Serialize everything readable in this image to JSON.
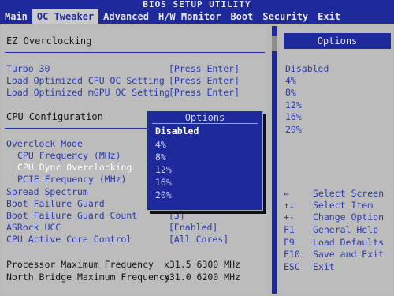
{
  "title": "BIOS SETUP UTILITY",
  "menu": [
    "Main",
    "OC Tweaker",
    "Advanced",
    "H/W Monitor",
    "Boot",
    "Security",
    "Exit"
  ],
  "left": {
    "section1": "EZ Overclocking",
    "items1": [
      {
        "label": "Turbo 30",
        "value": "[Press Enter]"
      },
      {
        "label": "Load Optimized CPU OC Setting",
        "value": "[Press Enter]"
      },
      {
        "label": "Load Optimized mGPU OC Setting",
        "value": "[Press Enter]"
      }
    ],
    "section2": "CPU Configuration",
    "items2": [
      {
        "label": "Overclock Mode"
      },
      {
        "label": "CPU Frequency (MHz)"
      },
      {
        "label": "CPU Dync Overclocking"
      },
      {
        "label": "PCIE Frequency (MHz)"
      },
      {
        "label": "Spread Spectrum"
      },
      {
        "label": "Boot Failure Guard"
      },
      {
        "label": "Boot Failure Guard Count",
        "value": "[3]"
      },
      {
        "label": "ASRock UCC",
        "value": "[Enabled]"
      },
      {
        "label": "CPU Active Core Control",
        "value": "[All Cores]"
      }
    ],
    "info": [
      {
        "label": "Processor Maximum Frequency",
        "value": "x31.5 6300 MHz"
      },
      {
        "label": "North Bridge Maximum Frequency",
        "value": "x31.0 6200 MHz"
      }
    ]
  },
  "right": {
    "header": "Options",
    "options": [
      "Disabled",
      "4%",
      "8%",
      "12%",
      "16%",
      "20%"
    ],
    "help": [
      {
        "key": "↔",
        "desc": "Select Screen"
      },
      {
        "key": "↑↓",
        "desc": "Select Item"
      },
      {
        "key": "+-",
        "desc": "Change Option"
      },
      {
        "key": "F1",
        "desc": "General Help"
      },
      {
        "key": "F9",
        "desc": "Load Defaults"
      },
      {
        "key": "F10",
        "desc": "Save and Exit"
      },
      {
        "key": "ESC",
        "desc": "Exit"
      }
    ]
  },
  "popup": {
    "title": "Options",
    "options": [
      "Disabled",
      "4%",
      "8%",
      "12%",
      "16%",
      "20%"
    ],
    "selected_index": 0
  },
  "colors": {
    "accent_blue": "#1e2a9c",
    "text_blue": "#2a3ab4",
    "panel_gray": "#bcbcbc"
  }
}
